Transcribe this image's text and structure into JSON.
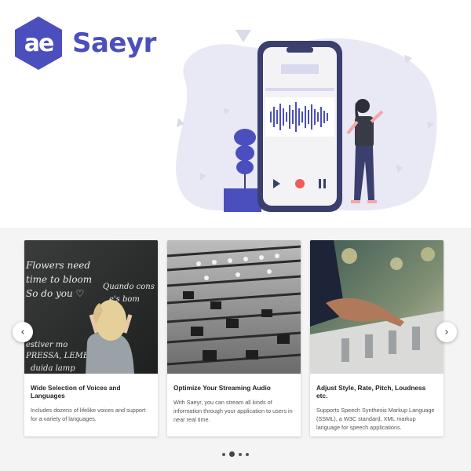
{
  "brand": {
    "logo_mark": "ae",
    "name": "Saeyr",
    "color": "#4a4fbd"
  },
  "hero": {
    "illustration": "woman-phone-audio-recording-illustration"
  },
  "carousel": {
    "prev_icon": "chevron-left-icon",
    "next_icon": "chevron-right-icon",
    "prev_glyph": "‹",
    "next_glyph": "›",
    "cards": [
      {
        "title": "Wide Selection of Voices and Languages",
        "description": "Includes dozens of lifelike voices and support for a variety of languages.",
        "image": "chalkboard-student-photo",
        "image_text": [
          "Flowers need",
          "time to bloom",
          "So do you ♡",
          "Quando cons",
          "e's bom",
          "estiver mo",
          "PRESSA, LEMBRE",
          "duida lamp"
        ]
      },
      {
        "title": "Optimize Your Streaming Audio",
        "description": "With Saeyr, you can stream all kinds of information through your application to users in near real time.",
        "image": "mixing-console-photo"
      },
      {
        "title": "Adjust Style, Rate, Pitch, Loudness etc.",
        "description": "Supports Speech Synthesis Markup Language (SSML), a W3C standard, XML markup language for speech applications.",
        "image": "hand-on-mixer-photo"
      }
    ],
    "pagination": {
      "count": 4,
      "active": 1
    }
  }
}
